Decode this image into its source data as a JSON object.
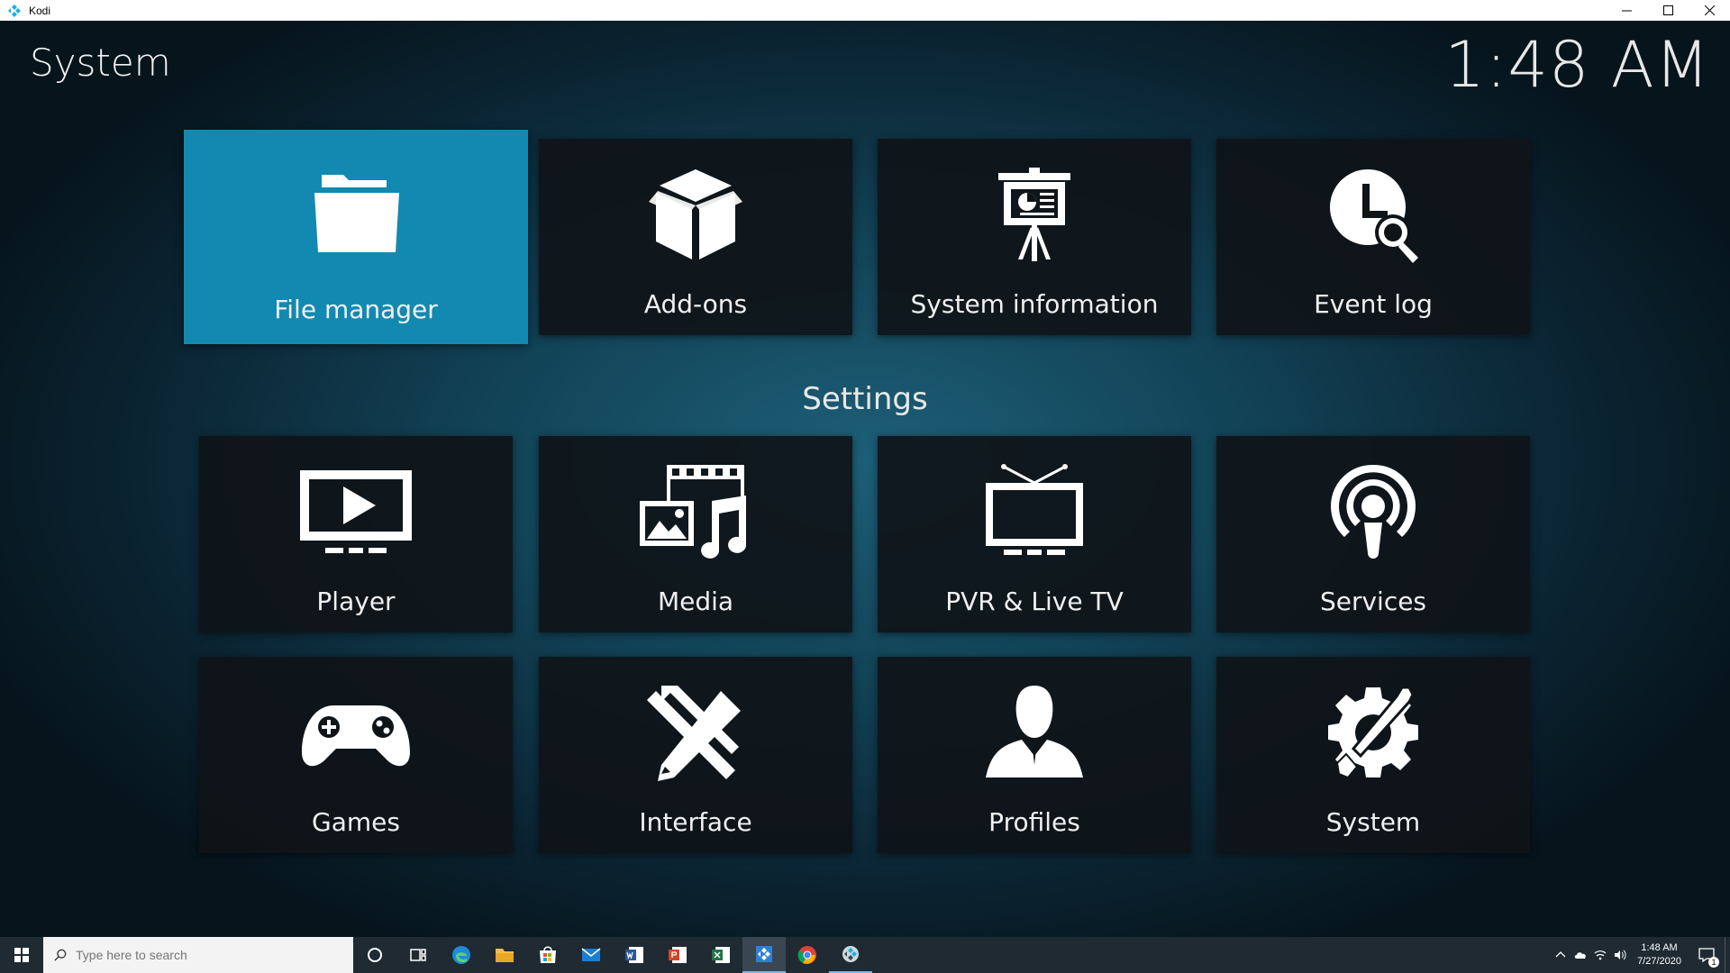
{
  "window": {
    "title": "Kodi",
    "controls": [
      "minimize-icon",
      "maximize-icon",
      "close-icon"
    ]
  },
  "header": {
    "title": "System",
    "clock": "1:48 AM"
  },
  "top_tiles": [
    {
      "label": "File manager",
      "icon": "folder-icon",
      "focused": true
    },
    {
      "label": "Add-ons",
      "icon": "box-icon"
    },
    {
      "label": "System information",
      "icon": "presentation-easel-icon"
    },
    {
      "label": "Event log",
      "icon": "clock-search-icon"
    }
  ],
  "settings": {
    "heading": "Settings",
    "tiles": [
      {
        "label": "Player",
        "icon": "monitor-play-icon"
      },
      {
        "label": "Media",
        "icon": "media-library-icon"
      },
      {
        "label": "PVR & Live TV",
        "icon": "tv-icon"
      },
      {
        "label": "Services",
        "icon": "broadcast-icon"
      },
      {
        "label": "Games",
        "icon": "gamepad-icon"
      },
      {
        "label": "Interface",
        "icon": "pencil-ruler-icon"
      },
      {
        "label": "Profiles",
        "icon": "person-icon"
      },
      {
        "label": "System",
        "icon": "gear-tools-icon"
      }
    ]
  },
  "taskbar": {
    "search_placeholder": "Type here to search",
    "pinned": [
      "cortana-icon",
      "task-view-icon",
      "edge-icon",
      "file-explorer-icon",
      "store-icon",
      "mail-icon",
      "word-icon",
      "powerpoint-icon",
      "excel-icon",
      "kodi-app-icon",
      "chrome-icon",
      "kodi-running-icon"
    ],
    "time": "1:48 AM",
    "date": "7/27/2020",
    "notification_count": "1"
  },
  "colors": {
    "focus": "#1289b0",
    "tile": "#0f1418",
    "taskbar": "#1f2a33"
  }
}
